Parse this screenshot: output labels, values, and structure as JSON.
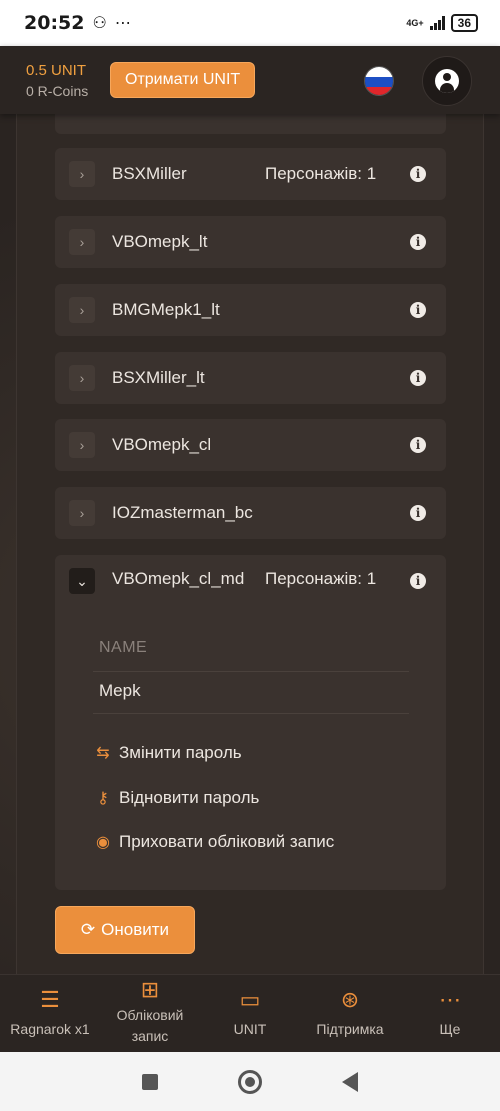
{
  "statusbar": {
    "time": "20:52",
    "extras": "⋯",
    "network": "4G+",
    "battery": "36"
  },
  "header": {
    "unit_balance": "0.5 UNIT",
    "rcoins_balance": "0 R-Coins",
    "get_unit_label": "Отримати UNIT",
    "language_flag": "russia-flag-icon",
    "profile_icon": "user-circle-icon"
  },
  "accounts": [
    {
      "name": "BSXMiller",
      "count": "Персонажів: 1"
    },
    {
      "name": "VBOmepk_lt",
      "count": ""
    },
    {
      "name": "BMGMepk1_lt",
      "count": ""
    },
    {
      "name": "BSXMiller_lt",
      "count": ""
    },
    {
      "name": "VBOmepk_cl",
      "count": ""
    },
    {
      "name": "IOZmasterman_bc",
      "count": ""
    }
  ],
  "expanded_account": {
    "name": "VBOmepk_cl_md",
    "count": "Персонажів: 1",
    "field_label": "NAME",
    "field_value": "Mepk",
    "actions": {
      "change_password": "Змінити пароль",
      "restore_password": "Відновити пароль",
      "hide_account": "Приховати обліковий запис"
    }
  },
  "refresh_label": "Оновити",
  "colors": {
    "accent": "#eb8f3c",
    "background": "#2a2421",
    "row": "#3a322e"
  },
  "bottomnav": [
    {
      "label": "Ragnarok x1",
      "icon": "database-icon"
    },
    {
      "label": "Обліковий запис",
      "icon": "gamepad-icon"
    },
    {
      "label": "UNIT",
      "icon": "wallet-icon"
    },
    {
      "label": "Підтримка",
      "icon": "lifebuoy-icon"
    },
    {
      "label": "Ще",
      "icon": "more-dots-icon"
    }
  ]
}
